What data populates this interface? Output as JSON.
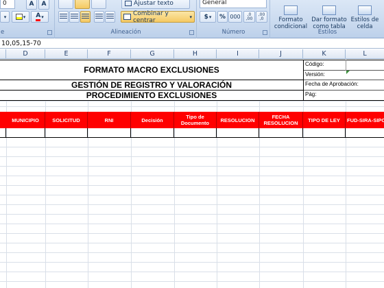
{
  "ribbon": {
    "font": {
      "size_partial": "0",
      "grow_button": "A",
      "shrink_button": "A",
      "font_color_letter": "A",
      "group_label_partial": "e"
    },
    "alignment": {
      "wrap_text": "Ajustar texto",
      "merge_center": "Combinar y centrar",
      "group_label": "Alineación"
    },
    "number": {
      "format_value": "General",
      "currency_symbol": "$",
      "percent_symbol": "%",
      "thousands": "000",
      "inc_decimals": ",0 ,00",
      "dec_decimals": ",00 ,0",
      "group_label": "Número"
    },
    "styles": {
      "conditional_format": "Formato condicional",
      "format_table": "Dar formato como tabla",
      "cell_styles": "Estilos de celda",
      "group_label": "Estilos"
    }
  },
  "formula_bar": {
    "content": "10,05,15-70"
  },
  "columns": [
    "D",
    "E",
    "F",
    "G",
    "H",
    "I",
    "J",
    "K",
    "L"
  ],
  "sheet": {
    "title1": "FORMATO MACRO EXCLUSIONES",
    "title2": "GESTIÓN DE REGISTRO Y VALORACIÓN",
    "title3": "PROCEDIMIENTO EXCLUSIONES",
    "meta": {
      "codigo": "Código:",
      "version": "Versión:",
      "fecha": "Fecha de Aprobación:",
      "pag": "Pág:"
    },
    "header_row": [
      "MUNICIPIO",
      "SOLICITUD",
      "RNI",
      "Decisión",
      "Tipo de Documento",
      "RESOLUCION",
      "FECHA RESOLUCION",
      "TIPO DE LEY",
      "FUD-SIRA-SIPOD"
    ]
  },
  "colors": {
    "header_fill": "#ff0000",
    "header_text": "#ffffff",
    "ribbon_bg": "#c7d8ee",
    "highlight": "#f5c963"
  },
  "icons": [
    "align-left-icon",
    "align-center-icon",
    "align-right-icon",
    "decrease-indent-icon",
    "increase-indent-icon",
    "merge-cells-icon",
    "currency-icon",
    "percent-icon",
    "conditional-format-icon",
    "format-table-icon",
    "cell-styles-icon",
    "fill-color-icon",
    "font-color-icon"
  ]
}
